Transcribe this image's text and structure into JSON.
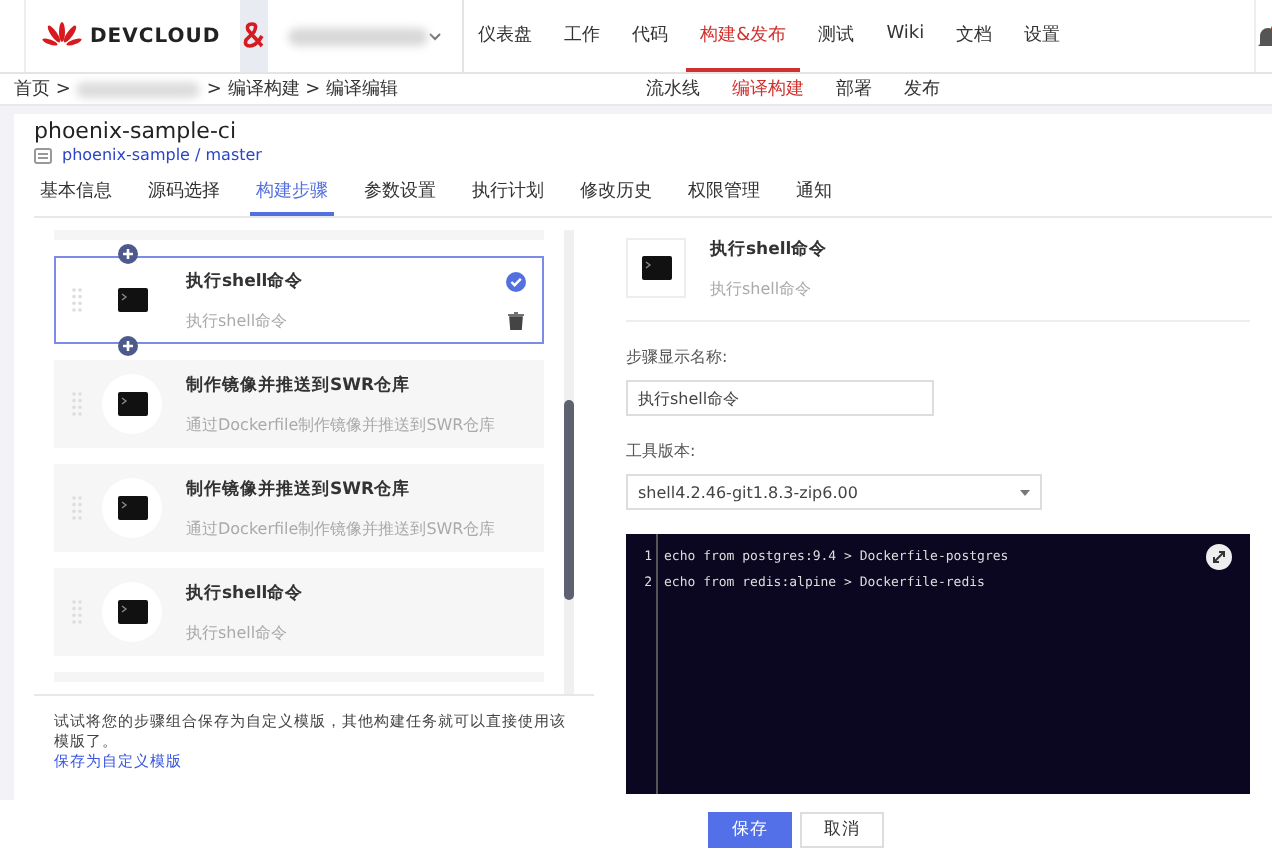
{
  "topnav": {
    "brand": "DEVCLOUD",
    "items": [
      {
        "label": "仪表盘",
        "selected": false
      },
      {
        "label": "工作",
        "selected": false
      },
      {
        "label": "代码",
        "selected": false
      },
      {
        "label": "构建&发布",
        "selected": true
      },
      {
        "label": "测试",
        "selected": false
      },
      {
        "label": "Wiki",
        "selected": false
      },
      {
        "label": "文档",
        "selected": false
      },
      {
        "label": "设置",
        "selected": false
      }
    ],
    "notification": true
  },
  "breadcrumb": {
    "home": "首页 >",
    "rest": "> 编译构建 > 编译编辑"
  },
  "subnav": [
    {
      "label": "流水线",
      "selected": false
    },
    {
      "label": "编译构建",
      "selected": true
    },
    {
      "label": "部署",
      "selected": false
    },
    {
      "label": "发布",
      "selected": false
    }
  ],
  "job": {
    "title": "phoenix-sample-ci",
    "repo": "phoenix-sample / master"
  },
  "tabs": [
    {
      "label": "基本信息",
      "selected": false
    },
    {
      "label": "源码选择",
      "selected": false
    },
    {
      "label": "构建步骤",
      "selected": true
    },
    {
      "label": "参数设置",
      "selected": false
    },
    {
      "label": "执行计划",
      "selected": false
    },
    {
      "label": "修改历史",
      "selected": false
    },
    {
      "label": "权限管理",
      "selected": false
    },
    {
      "label": "通知",
      "selected": false
    }
  ],
  "steps": [
    {
      "name": "执行shell命令",
      "desc": "执行shell命令",
      "selected": true
    },
    {
      "name": "制作镜像并推送到SWR仓库",
      "desc": "通过Dockerfile制作镜像并推送到SWR仓库",
      "selected": false
    },
    {
      "name": "制作镜像并推送到SWR仓库",
      "desc": "通过Dockerfile制作镜像并推送到SWR仓库",
      "selected": false
    },
    {
      "name": "执行shell命令",
      "desc": "执行shell命令",
      "selected": false
    }
  ],
  "template_hint": "试试将您的步骤组合保存为自定义模版，其他构建任务就可以直接使用该模版了。",
  "template_link": "保存为自定义模版",
  "detail": {
    "name": "执行shell命令",
    "desc": "执行shell命令",
    "name_label": "步骤显示名称:",
    "name_value": "执行shell命令",
    "tool_label": "工具版本:",
    "tool_value": "shell4.2.46-git1.8.3-zip6.00",
    "code": [
      {
        "num": "1",
        "text": "echo from postgres:9.4 > Dockerfile-postgres"
      },
      {
        "num": "2",
        "text": "echo from redis:alpine > Dockerfile-redis"
      }
    ]
  },
  "buttons": [
    "保存",
    "取消"
  ]
}
